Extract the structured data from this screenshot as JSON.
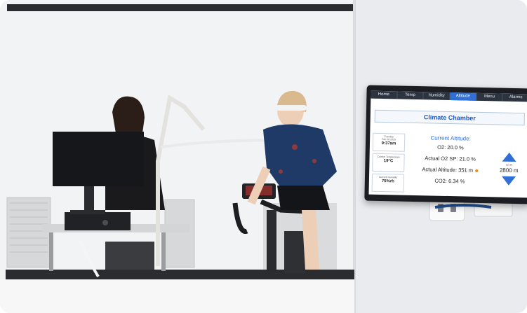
{
  "panel": {
    "tabs": [
      {
        "label": "Home"
      },
      {
        "label": "Temp"
      },
      {
        "label": "Humidity"
      },
      {
        "label": "Altitude",
        "active": true
      },
      {
        "label": "Menu"
      },
      {
        "label": "Alarms"
      }
    ],
    "title": "Climate Chamber",
    "date_line": "Tuesday",
    "date_line2": "Feb 18 2025",
    "time": "9:37am",
    "temp_caption": "Current Temperature",
    "temp_value": "19°C",
    "humidity_caption": "Current Humidity",
    "humidity_value": "75%rh",
    "current_altitude_label": "Current Altitude:",
    "o2": "O2: 20.0 %",
    "o2_sp": "Actual O2 SP: 21.0 %",
    "altitude": "Actual Altitude: 351 m",
    "co2": "CO2: 6.34 %",
    "setpoint_caption": "Set Pt",
    "setpoint_value": "2800 m"
  },
  "colors": {
    "accent": "#2f6fd6",
    "tab_bar": "#2c3440",
    "jersey": "#1f3a66",
    "wall": "#eef0f2"
  }
}
